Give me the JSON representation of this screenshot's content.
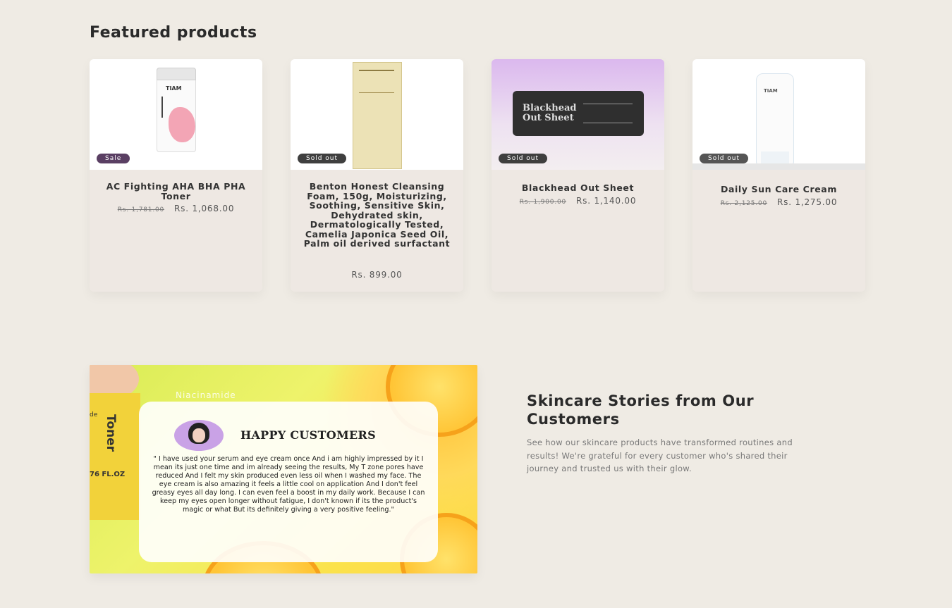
{
  "featured": {
    "title": "Featured products",
    "products": [
      {
        "name": "AC Fighting AHA BHA PHA Toner",
        "badge": "Sale",
        "price_old": "Rs. 1,781.00",
        "price": "Rs. 1,068.00"
      },
      {
        "name": "Benton Honest Cleansing Foam, 150g, Moisturizing, Soothing, Sensitive Skin, Dehydrated skin, Dermatologically Tested, Camelia Japonica Seed Oil, Palm oil derived surfactant",
        "badge": "Sold out",
        "price": "Rs. 899.00"
      },
      {
        "name": "Blackhead Out Sheet",
        "badge": "Sold out",
        "price_old": "Rs. 1,900.00",
        "price": "Rs. 1,140.00"
      },
      {
        "name": "Daily Sun Care Cream",
        "badge": "Sold out",
        "price_old": "Rs. 2,125.00",
        "price": "Rs. 1,275.00"
      }
    ]
  },
  "images": {
    "toner_brand": "TIAM",
    "jar_label": "Blackhead Out Sheet",
    "sun_brand": "TIAM",
    "side_label_top": "de",
    "side_label_vertical": "Toner",
    "side_label_bottom": "76 FL.OZ",
    "niacinamide": "Niacinamide"
  },
  "testimonial": {
    "title": "HAPPY CUSTOMERS",
    "quote": "\" I have used your serum and eye cream once And i am highly impressed by it I mean its just one time and im already seeing the results, My T zone pores have reduced And I felt my skin produced even less oil when I washed my face. The eye cream is also amazing it feels a little cool on application And I don't feel greasy eyes all day long. I can even feel a boost in my daily work. Because I can keep my eyes open longer without fatigue, I don't known if its the product's magic or what But its definitely giving a very positive feeling.\""
  },
  "stories": {
    "heading": "Skincare Stories from Our Customers",
    "text": "See how our skincare products have transformed routines and results! We're grateful for every customer who's shared their journey and trusted us with their glow."
  },
  "colors": {
    "background": "#efebe4",
    "sale_badge": "#5a3f63",
    "soldout_badge": "#3f3f3f"
  }
}
